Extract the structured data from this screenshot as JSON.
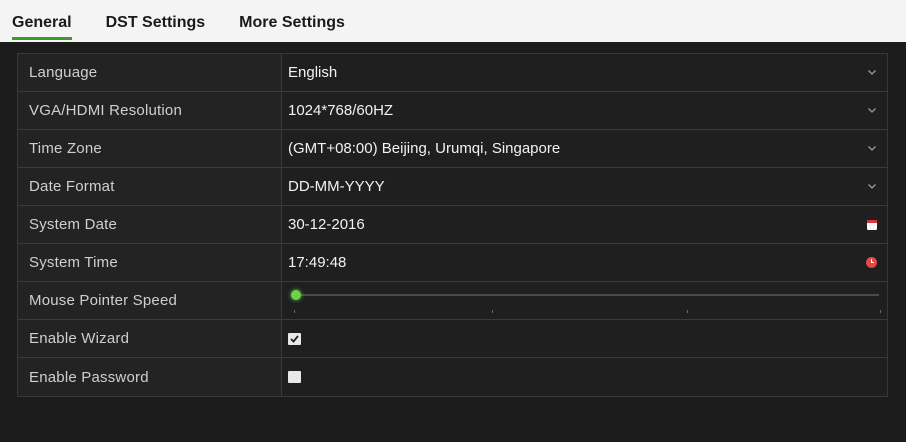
{
  "tabs": [
    {
      "label": "General",
      "active": true
    },
    {
      "label": "DST Settings",
      "active": false
    },
    {
      "label": "More Settings",
      "active": false
    }
  ],
  "rows": {
    "language": {
      "label": "Language",
      "value": "English"
    },
    "resolution": {
      "label": "VGA/HDMI Resolution",
      "value": "1024*768/60HZ"
    },
    "timezone": {
      "label": "Time Zone",
      "value": "(GMT+08:00) Beijing, Urumqi, Singapore"
    },
    "date_format": {
      "label": "Date Format",
      "value": "DD-MM-YYYY"
    },
    "system_date": {
      "label": "System Date",
      "value": "30-12-2016"
    },
    "system_time": {
      "label": "System Time",
      "value": "17:49:48"
    },
    "mouse_speed": {
      "label": "Mouse Pointer Speed",
      "level_fraction": 0.0
    },
    "enable_wizard": {
      "label": "Enable Wizard",
      "checked": true
    },
    "enable_password": {
      "label": "Enable Password",
      "checked": false
    }
  },
  "colors": {
    "accent": "#3c9a2c",
    "slider_knob": "#6bd24a",
    "calendar_icon": "#d9383a",
    "clock_icon": "#e24a4a"
  },
  "icons": {
    "dropdown": "chevron-down-icon",
    "calendar": "calendar-icon",
    "clock": "clock-icon",
    "checkbox_checked": "checkmark-icon"
  }
}
